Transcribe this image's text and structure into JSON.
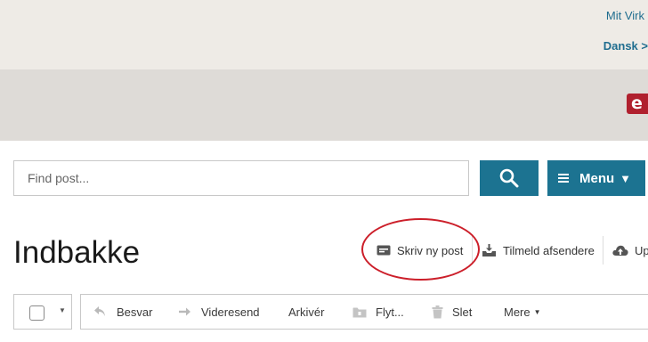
{
  "header": {
    "top_link": "Mit Virk",
    "language_link": "Dansk >",
    "logo_letter": "e",
    "logo_color": "#b0202e"
  },
  "search": {
    "placeholder": "Find post...",
    "value": "",
    "icon": "search-icon"
  },
  "menu": {
    "label": "Menu",
    "caret": "▼",
    "icon": "hamburger-icon"
  },
  "accent_color": "#1c7391",
  "page_title": "Indbakke",
  "actions": [
    {
      "label": "Skriv ny post",
      "icon": "compose-icon"
    },
    {
      "label": "Tilmeld afsendere",
      "icon": "inbox-download-icon"
    },
    {
      "label": "Up",
      "icon": "cloud-upload-icon"
    }
  ],
  "toolbar": {
    "select_caret": "▼",
    "reply": "Besvar",
    "forward": "Videresend",
    "archive": "Arkivér",
    "move": "Flyt...",
    "delete": "Slet",
    "more": "Mere",
    "more_caret": "▼"
  },
  "highlight_color": "#cc1f2a"
}
